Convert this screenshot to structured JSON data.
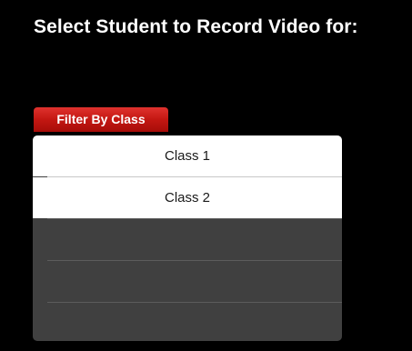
{
  "header": {
    "title": "Select Student to Record Video for:"
  },
  "filter": {
    "button_label": "Filter By Class",
    "options": [
      {
        "label": "Class 1"
      },
      {
        "label": "Class 2"
      }
    ]
  },
  "colors": {
    "background": "#000000",
    "accent_red": "#c31712",
    "popover_gray": "#404040"
  }
}
